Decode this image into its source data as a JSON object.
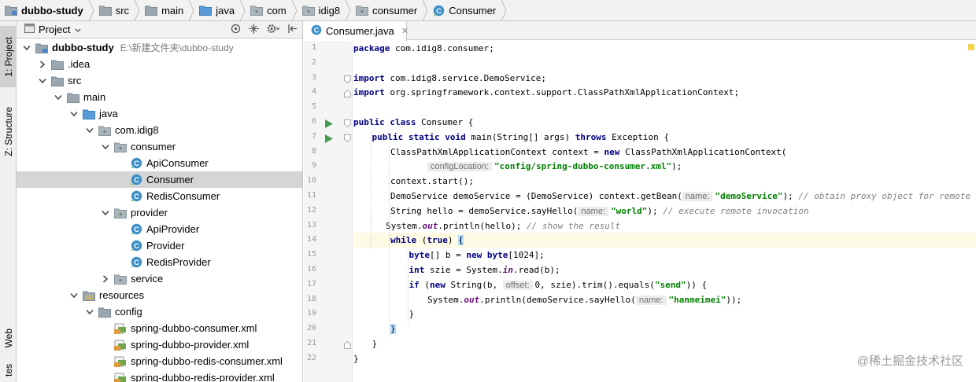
{
  "breadcrumb": [
    {
      "label": "dubbo-study",
      "icon": "module-folder-icon",
      "bold": true
    },
    {
      "label": "src",
      "icon": "folder-icon"
    },
    {
      "label": "main",
      "icon": "folder-icon"
    },
    {
      "label": "java",
      "icon": "source-folder-icon"
    },
    {
      "label": "com",
      "icon": "package-icon"
    },
    {
      "label": "idig8",
      "icon": "package-icon"
    },
    {
      "label": "consumer",
      "icon": "package-icon"
    },
    {
      "label": "Consumer",
      "icon": "java-class-icon"
    }
  ],
  "toolstrip": {
    "project_tab": "1: Project",
    "structure_tab": "Z: Structure",
    "web_tab": "Web",
    "favorites_tab": "tes"
  },
  "project_panel": {
    "title": "Project",
    "tree": [
      {
        "label": "dubbo-study",
        "path": "E:\\新建文件夹\\dubbo-study",
        "level": 0,
        "expanded": true,
        "icon": "module-folder-icon",
        "bold": true
      },
      {
        "label": ".idea",
        "level": 1,
        "expanded": false,
        "icon": "folder-icon"
      },
      {
        "label": "src",
        "level": 1,
        "expanded": true,
        "icon": "folder-icon"
      },
      {
        "label": "main",
        "level": 2,
        "expanded": true,
        "icon": "folder-icon"
      },
      {
        "label": "java",
        "level": 3,
        "expanded": true,
        "icon": "source-folder-icon"
      },
      {
        "label": "com.idig8",
        "level": 4,
        "expanded": true,
        "icon": "package-icon"
      },
      {
        "label": "consumer",
        "level": 5,
        "expanded": true,
        "icon": "package-icon"
      },
      {
        "label": "ApiConsumer",
        "level": 6,
        "icon": "java-class-icon"
      },
      {
        "label": "Consumer",
        "level": 6,
        "icon": "java-class-icon",
        "selected": true
      },
      {
        "label": "RedisConsumer",
        "level": 6,
        "icon": "java-class-icon"
      },
      {
        "label": "provider",
        "level": 5,
        "expanded": true,
        "icon": "package-icon"
      },
      {
        "label": "ApiProvider",
        "level": 6,
        "icon": "java-class-icon"
      },
      {
        "label": "Provider",
        "level": 6,
        "icon": "java-class-icon"
      },
      {
        "label": "RedisProvider",
        "level": 6,
        "icon": "java-class-icon"
      },
      {
        "label": "service",
        "level": 5,
        "expanded": false,
        "icon": "package-icon"
      },
      {
        "label": "resources",
        "level": 3,
        "expanded": true,
        "icon": "resources-folder-icon"
      },
      {
        "label": "config",
        "level": 4,
        "expanded": true,
        "icon": "folder-icon"
      },
      {
        "label": "spring-dubbo-consumer.xml",
        "level": 5,
        "icon": "xml-file-icon"
      },
      {
        "label": "spring-dubbo-provider.xml",
        "level": 5,
        "icon": "xml-file-icon"
      },
      {
        "label": "spring-dubbo-redis-consumer.xml",
        "level": 5,
        "icon": "xml-file-icon"
      },
      {
        "label": "spring-dubbo-redis-provider.xml",
        "level": 5,
        "icon": "xml-file-icon"
      }
    ]
  },
  "editor": {
    "tab_label": "Consumer.java",
    "lines": [
      "1",
      "2",
      "3",
      "4",
      "5",
      "6",
      "7",
      "8",
      "9",
      "10",
      "11",
      "12",
      "13",
      "14",
      "15",
      "16",
      "17",
      "18",
      "19",
      "20",
      "21",
      "22"
    ],
    "code": {
      "l1_kw": "package",
      "l1_rest": " com.idig8.consumer;",
      "l3_kw": "import",
      "l3_rest": " com.idig8.service.DemoService;",
      "l4_kw": "import",
      "l4_rest": " org.springframework.context.support.ClassPathXmlApplicationContext;",
      "l6_kw": "public class",
      "l6_rest": " Consumer {",
      "l7_kw1": "public static void",
      "l7_mid": " main(String[] args) ",
      "l7_kw2": "throws",
      "l7_rest": " Exception {",
      "l8_a": "ClassPathXmlApplicationContext context = ",
      "l8_kw": "new",
      "l8_b": " ClassPathXmlApplicationContext(",
      "l9_hint": "configLocation:",
      "l9_str": "\"config/spring-dubbo-consumer.xml\"",
      "l9_rest": ");",
      "l10": "context.start();",
      "l11_a": "DemoService demoService = (DemoService) context.getBean(",
      "l11_hint": "name:",
      "l11_str": "\"demoService\"",
      "l11_b": "); ",
      "l11_cm": "// obtain proxy object for remote invocation",
      "l12_a": "String hello = demoService.sayHello(",
      "l12_hint": "name:",
      "l12_str": "\"world\"",
      "l12_b": "); ",
      "l12_cm": "// execute remote invocation",
      "l13_a": "System.",
      "l13_st": "out",
      "l13_b": ".println(hello); ",
      "l13_cm": "// show the result",
      "l14_kw": "while",
      "l14_a": " (",
      "l14_kw2": "true",
      "l14_b": ") ",
      "l14_brace": "{",
      "l15_kw": "byte",
      "l15_a": "[] b = ",
      "l15_kw2": "new",
      "l15_sp": " ",
      "l15_kw3": "byte",
      "l15_b": "[1024];",
      "l16_kw": "int",
      "l16_a": " szie = System.",
      "l16_st": "in",
      "l16_b": ".read(b);",
      "l17_kw": "if",
      "l17_a": " (",
      "l17_kw2": "new",
      "l17_b": " String(b, ",
      "l17_hint": "offset:",
      "l17_c": "0, szie).trim().equals(",
      "l17_str": "\"send\"",
      "l17_d": ")) {",
      "l18_a": "System.",
      "l18_st": "out",
      "l18_b": ".println(demoService.sayHello(",
      "l18_hint": "name:",
      "l18_str": "\"hanmeimei\"",
      "l18_c": "));",
      "l19": "}",
      "l20_brace": "}",
      "l21": "}",
      "l22": "}"
    }
  },
  "watermark": "@稀土掘金技术社区",
  "colors": {
    "keyword": "#000080",
    "string": "#008000",
    "comment": "#808080",
    "current_line": "#fffae3",
    "selection": "#d5d5d5"
  }
}
